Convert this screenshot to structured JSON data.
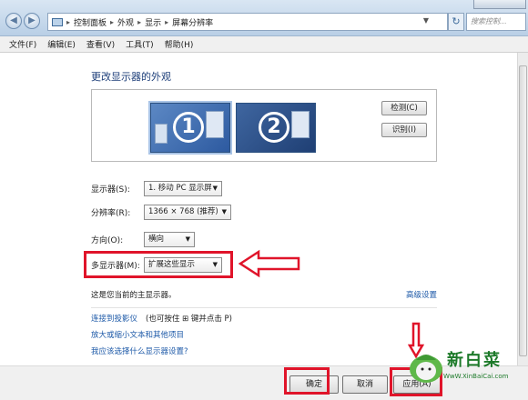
{
  "address": {
    "crumbs": [
      "控制面板",
      "外观",
      "显示",
      "屏幕分辨率"
    ],
    "search_placeholder": "搜索控制..."
  },
  "menu": [
    "文件(F)",
    "编辑(E)",
    "查看(V)",
    "工具(T)",
    "帮助(H)"
  ],
  "main": {
    "title": "更改显示器的外观",
    "monitors": [
      "1",
      "2"
    ],
    "detect_button": "检测(C)",
    "identify_button": "识别(I)",
    "display_label": "显示器(S):",
    "display_value": "1. 移动 PC 显示屏",
    "resolution_label": "分辨率(R):",
    "resolution_value": "1366 × 768 (推荐)",
    "orientation_label": "方向(O):",
    "orientation_value": "横向",
    "multi_label": "多显示器(M):",
    "multi_value": "扩展这些显示",
    "primary_note": "这是您当前的主显示器。",
    "advanced_link": "高级设置",
    "projector_link": "连接到投影仪",
    "projector_hint": "(也可按住 ⊞ 键并点击 P)",
    "text_size_link": "放大或缩小文本和其他项目",
    "choose_link": "我应该选择什么显示器设置?"
  },
  "footer": {
    "ok": "确定",
    "cancel": "取消",
    "apply": "应用(A)"
  },
  "watermark": {
    "name": "新白菜",
    "url": "WwW.XinBaiCai.com"
  },
  "colors": {
    "highlight": "#e0142a",
    "link": "#1e5aa8",
    "title": "#1e3f7a"
  }
}
